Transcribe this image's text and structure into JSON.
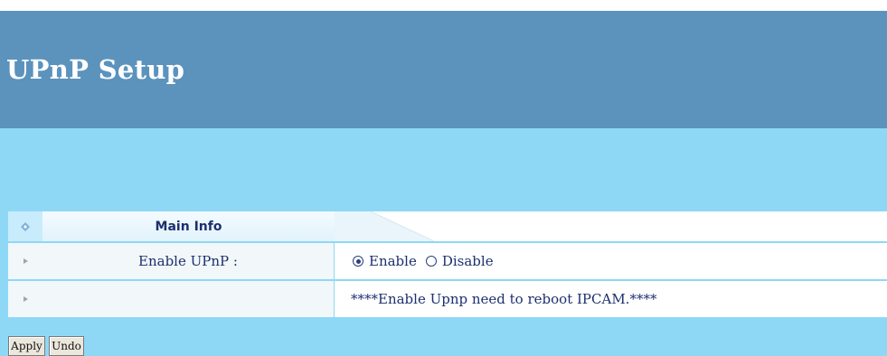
{
  "page": {
    "title": "UPnP Setup"
  },
  "section": {
    "caption": "Main Info"
  },
  "rows": [
    {
      "label": "Enable UPnP :",
      "options": [
        "Enable",
        "Disable"
      ],
      "selected": "Enable"
    },
    {
      "label": "",
      "note": "****Enable Upnp need to reboot IPCAM.****"
    }
  ],
  "buttons": {
    "apply": "Apply",
    "undo": "Undo"
  },
  "colors": {
    "header": "#5b93bd",
    "band": "#8ed8f6",
    "text": "#1c2f70"
  },
  "icons": {
    "header_bullet": "diamond-bullet-icon",
    "row_bullet": "arrow-bullet-icon",
    "radio": "radio-icon"
  }
}
